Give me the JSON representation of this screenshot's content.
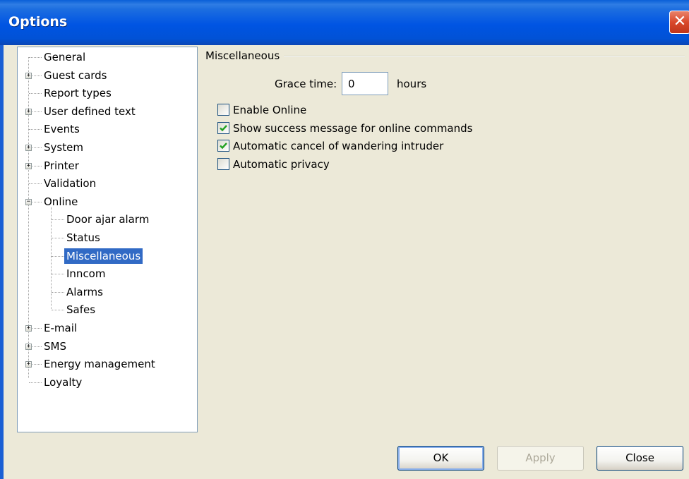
{
  "window": {
    "title": "Options",
    "close_glyph": "✕"
  },
  "tree": {
    "items": [
      {
        "label": "General"
      },
      {
        "label": "Guest cards"
      },
      {
        "label": "Report types"
      },
      {
        "label": "User defined text"
      },
      {
        "label": "Events"
      },
      {
        "label": "System"
      },
      {
        "label": "Printer"
      },
      {
        "label": "Validation"
      },
      {
        "label": "Online"
      },
      {
        "label": "Door ajar alarm"
      },
      {
        "label": "Status"
      },
      {
        "label": "Miscellaneous"
      },
      {
        "label": "Inncom"
      },
      {
        "label": "Alarms"
      },
      {
        "label": "Safes"
      },
      {
        "label": "E-mail"
      },
      {
        "label": "SMS"
      },
      {
        "label": "Energy management"
      },
      {
        "label": "Loyalty"
      }
    ],
    "selected": "Miscellaneous"
  },
  "panel": {
    "group_title": "Miscellaneous",
    "grace_label": "Grace time:",
    "grace_value": "0",
    "grace_unit": "hours",
    "checkboxes": [
      {
        "label": "Enable Online",
        "checked": false
      },
      {
        "label": "Show success message for online commands",
        "checked": true
      },
      {
        "label": "Automatic cancel of wandering intruder",
        "checked": true
      },
      {
        "label": "Automatic privacy",
        "checked": false
      }
    ]
  },
  "buttons": {
    "ok": "OK",
    "apply": "Apply",
    "close": "Close"
  }
}
